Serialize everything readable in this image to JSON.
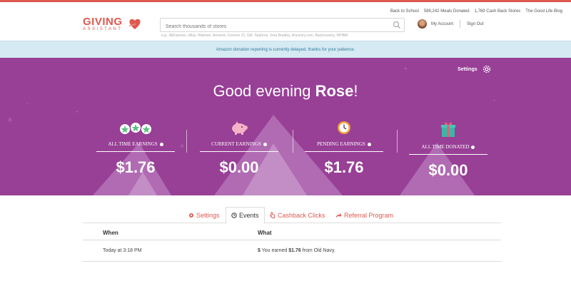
{
  "logo": {
    "main": "GIVING",
    "sub": "ASSISTANT"
  },
  "search": {
    "placeholder": "Search thousands of stores",
    "examples": "e.g.: AliExpress, eBay, Walmart, Amazon, Forever 21, Gilt, Sephora, Vera Bradley, Ancestry.com, Backcountry, WHBM"
  },
  "toplinks": [
    "Back to School",
    "589,242 Meals Donated",
    "1,769 Cash Back Stores",
    "The Good Life Blog"
  ],
  "account": {
    "my_account": "My Account",
    "sign_out": "Sign Out"
  },
  "notice": "Amazon donation reporting is currently delayed, thanks for your patience.",
  "hero": {
    "settings": "Settings",
    "greeting_prefix": "Good evening",
    "name": "Rose",
    "greeting_suffix": "!",
    "stats": [
      {
        "label": "All Time Earnings",
        "value": "$1.76"
      },
      {
        "label": "Current Earnings",
        "value": "$0.00"
      },
      {
        "label": "Pending Earnings",
        "value": "$1.76"
      },
      {
        "label": "All Time Donated",
        "value": "$0.00"
      }
    ]
  },
  "tabs": [
    {
      "label": "Settings",
      "icon": "gear-icon"
    },
    {
      "label": "Events",
      "icon": "clock-icon"
    },
    {
      "label": "Cashback Clicks",
      "icon": "pointer-icon"
    },
    {
      "label": "Referral Program",
      "icon": "share-arrow-icon"
    }
  ],
  "table": {
    "headers": [
      "When",
      "What"
    ],
    "rows": [
      {
        "when": "Today at 3:18 PM",
        "currency": "$",
        "prefix": "You earned",
        "amount": "$1.76",
        "suffix": "from Old Navy."
      }
    ]
  },
  "colors": {
    "brand": "#e0584f",
    "hero_bg": "#983f96",
    "notice_bg": "#d6eaf3"
  }
}
